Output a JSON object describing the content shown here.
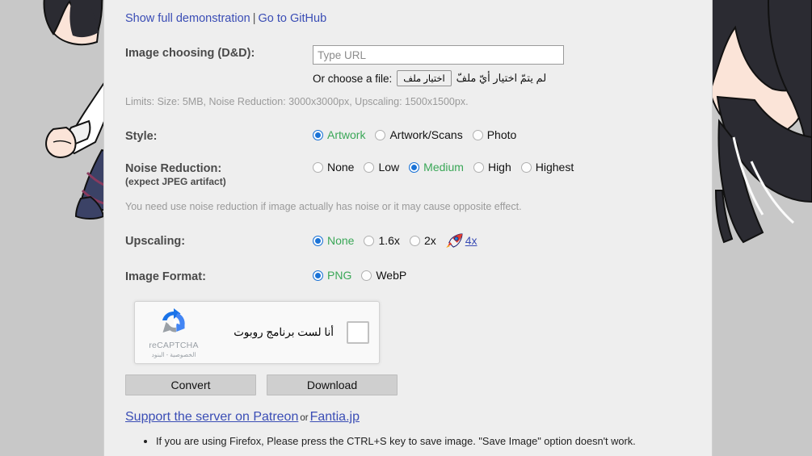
{
  "top_links": {
    "demo_label": "Show full demonstration",
    "separator": "|",
    "github_label": "Go to GitHub"
  },
  "form": {
    "image_choosing": {
      "label": "Image choosing (D&D):",
      "url_placeholder": "Type URL",
      "url_value": "",
      "choose_file_label": "Or choose a file:",
      "file_button_label": "اختيار ملف",
      "file_status": "لم يتمّ اختيار أيّ ملفّ",
      "limits": "Limits: Size: 5MB, Noise Reduction: 3000x3000px, Upscaling: 1500x1500px."
    },
    "style": {
      "label": "Style:",
      "options": [
        {
          "label": "Artwork",
          "selected": true
        },
        {
          "label": "Artwork/Scans",
          "selected": false
        },
        {
          "label": "Photo",
          "selected": false
        }
      ]
    },
    "noise_reduction": {
      "label": "Noise Reduction:",
      "sublabel": "(expect JPEG artifact)",
      "options": [
        {
          "label": "None",
          "selected": false
        },
        {
          "label": "Low",
          "selected": false
        },
        {
          "label": "Medium",
          "selected": true
        },
        {
          "label": "High",
          "selected": false
        },
        {
          "label": "Highest",
          "selected": false
        }
      ],
      "help": "You need use noise reduction if image actually has noise or it may cause opposite effect."
    },
    "upscaling": {
      "label": "Upscaling:",
      "options": [
        {
          "label": "None",
          "selected": true
        },
        {
          "label": "1.6x",
          "selected": false
        },
        {
          "label": "2x",
          "selected": false
        }
      ],
      "premium": {
        "icon": "rocket-icon",
        "label": "4x"
      }
    },
    "image_format": {
      "label": "Image Format:",
      "options": [
        {
          "label": "PNG",
          "selected": true
        },
        {
          "label": "WebP",
          "selected": false
        }
      ]
    }
  },
  "recaptcha": {
    "text": "أنا لست برنامج روبوت",
    "brand": "reCAPTCHA",
    "legal": "الخصوصية - البنود",
    "checked": false
  },
  "actions": {
    "convert_label": "Convert",
    "download_label": "Download"
  },
  "support": {
    "patreon_label": "Support the server on Patreon",
    "or_label": "or",
    "fantia_label": "Fantia.jp"
  },
  "notes": [
    "If you are using Firefox, Please press the CTRL+S key to save image. \"Save Image\" option doesn't work."
  ],
  "colors": {
    "page_background": "#c8c8c8",
    "panel_background": "#eeeeee",
    "link": "#3a4db5",
    "selected_option": "#3aa757",
    "radio_checked": "#1b73d6",
    "button_face": "#cfcfcf",
    "muted_text": "#9a9a9a"
  }
}
